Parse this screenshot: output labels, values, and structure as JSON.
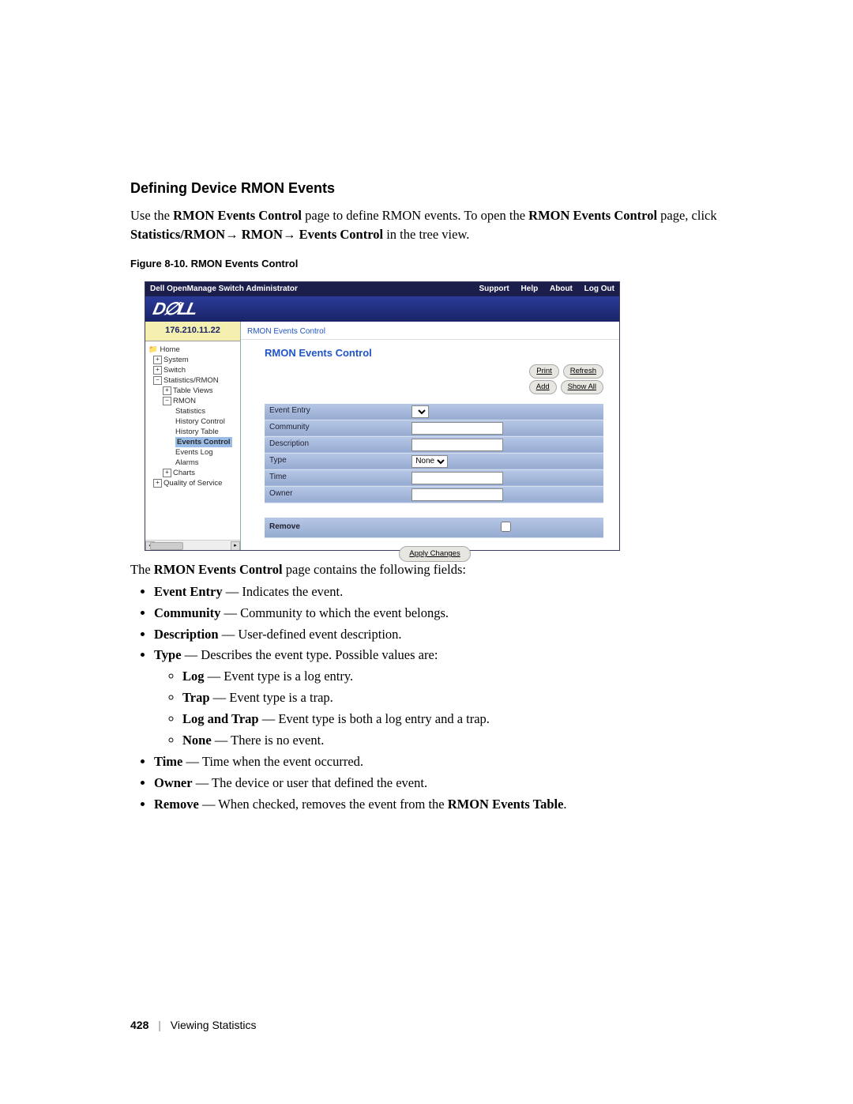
{
  "section_title": "Defining Device RMON Events",
  "intro": {
    "pre1": "Use the ",
    "b1": "RMON Events Control",
    "mid1": " page to define RMON events. To open the ",
    "b2": "RMON Events Control",
    "mid2": " page, click ",
    "b3": "Statistics/RMON",
    "arrow1": "→ ",
    "b4": "RMON",
    "arrow2": "→ ",
    "b5": "Events Control",
    "post": " in the tree view."
  },
  "figure_caption": "Figure 8-10.    RMON Events Control",
  "shot": {
    "header": "Dell OpenManage Switch Administrator",
    "nav": [
      "Support",
      "Help",
      "About",
      "Log Out"
    ],
    "logo": "D∅LL",
    "ip": "176.210.11.22",
    "breadcrumb": "RMON Events Control",
    "main_title": "RMON Events Control",
    "buttons": {
      "print": "Print",
      "refresh": "Refresh",
      "add": "Add",
      "showall": "Show All",
      "apply": "Apply Changes"
    },
    "tree": {
      "home": "Home",
      "system": "System",
      "switch": "Switch",
      "stats": "Statistics/RMON",
      "tableviews": "Table Views",
      "rmon": "RMON",
      "statistics": "Statistics",
      "histctrl": "History Control",
      "histtable": "History Table",
      "eventsctrl": "Events Control",
      "eventslog": "Events Log",
      "alarms": "Alarms",
      "charts": "Charts",
      "qos": "Quality of Service"
    },
    "form": {
      "event_entry": "Event Entry",
      "community": "Community",
      "description": "Description",
      "type": "Type",
      "type_value": "None",
      "time": "Time",
      "owner": "Owner",
      "remove": "Remove"
    }
  },
  "after": {
    "pre": "The ",
    "b": "RMON Events Control",
    "post": " page contains the following fields:"
  },
  "fields": {
    "event_entry": {
      "b": "Event Entry",
      "rest": " — Indicates the event."
    },
    "community": {
      "b": "Community",
      "rest": " — Community to which the event belongs."
    },
    "description": {
      "b": "Description",
      "rest": " — User-defined event description."
    },
    "type": {
      "b": "Type",
      "rest": " — Describes the event type. Possible values are:"
    },
    "type_opts": {
      "log": {
        "b": "Log",
        "rest": " — Event type is a log entry."
      },
      "trap": {
        "b": "Trap",
        "rest": " — Event type is a trap."
      },
      "logtrap": {
        "b": "Log and Trap",
        "rest": " — Event type is both a log entry and a trap."
      },
      "none": {
        "b": "None",
        "rest": " — There is no event."
      }
    },
    "time": {
      "b": "Time",
      "rest": " — Time when the event occurred."
    },
    "owner": {
      "b": "Owner",
      "rest": " — The device or user that defined the event."
    },
    "remove": {
      "b": "Remove",
      "pre": " — When checked, removes the event from the ",
      "b2": "RMON Events Table",
      "post": "."
    }
  },
  "footer": {
    "page": "428",
    "section": "Viewing Statistics"
  }
}
